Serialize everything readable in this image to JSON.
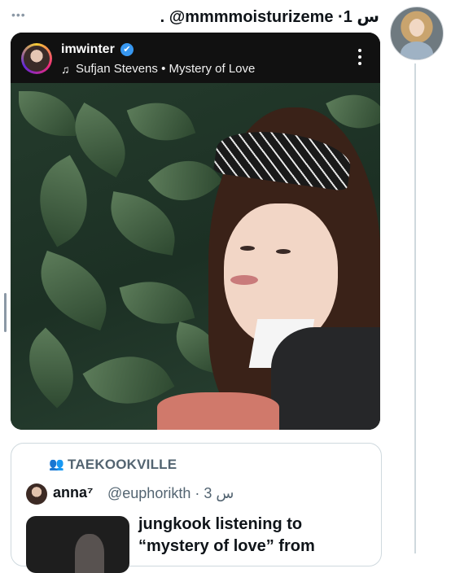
{
  "header": {
    "more_label": "•••",
    "line": ". @mmmmoisturizeme ·1 س"
  },
  "embed": {
    "username": "imwinter",
    "verified_mark": "✔",
    "song": "Sufjan Stevens • Mystery of Love",
    "music_icon": "♫"
  },
  "quote": {
    "community_icon": "👥",
    "community": "TAEKOOKVILLE",
    "name": "anna⁷",
    "handle": "@euphorikth · 3 س",
    "text": "jungkook listening to “mystery of love” from"
  },
  "colors": {
    "text": "#0f1419",
    "muted": "#536471",
    "border": "#cfd9de",
    "verified": "#3797f0"
  }
}
